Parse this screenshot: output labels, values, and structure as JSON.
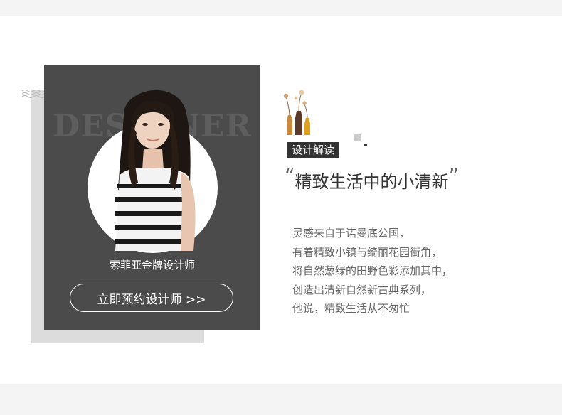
{
  "card": {
    "watermark": "DESIGNER",
    "designer_title": "索菲亚金牌设计师",
    "cta_label": "立即预约设计师 >>"
  },
  "feature": {
    "tag": "设计解读",
    "open_quote": "“",
    "headline": "精致生活中的小清新",
    "close_quote": "”",
    "lines": [
      "灵感来自于诺曼底公国，",
      "有着精致小镇与绮丽花园街角，",
      "将自然葱绿的田野色彩添加其中，",
      "创造出清新自然新古典系列，",
      "他说，精致生活从不匆忙"
    ]
  },
  "colors": {
    "card_bg": "#4b4b4b",
    "shadow": "#dcdcdc",
    "band": "#f4f4f4",
    "text_dark": "#333333",
    "text_body": "#666666"
  }
}
